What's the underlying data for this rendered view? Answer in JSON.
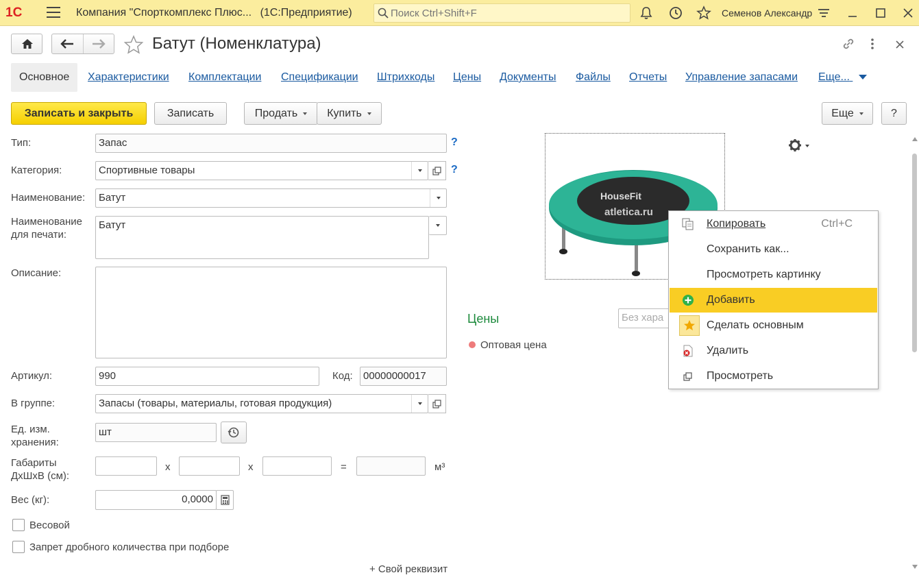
{
  "titlebar": {
    "logo": "1С",
    "title": "Компания \"Спорткомплекс Плюс\" (1С:Предприятие)",
    "title_short": "Компания \"Спорткомплекс Плюс...",
    "app_suffix": "(1С:Предприятие)",
    "search_placeholder": "Поиск Ctrl+Shift+F",
    "user": "Семенов Александр"
  },
  "form": {
    "title": "Батут (Номенклатура)"
  },
  "tabs": [
    {
      "label": "Основное",
      "active": true
    },
    {
      "label": "Характеристики"
    },
    {
      "label": "Комплектации"
    },
    {
      "label": "Спецификации"
    },
    {
      "label": "Штрихкоды"
    },
    {
      "label": "Цены"
    },
    {
      "label": "Документы"
    },
    {
      "label": "Файлы"
    },
    {
      "label": "Отчеты"
    },
    {
      "label": "Управление запасами"
    },
    {
      "label": "Еще..."
    }
  ],
  "toolbar": {
    "save_close": "Записать и закрыть",
    "save": "Записать",
    "sell": "Продать",
    "buy": "Купить",
    "more": "Еще",
    "help": "?"
  },
  "fields": {
    "type_label": "Тип:",
    "type_value": "Запас",
    "category_label": "Категория:",
    "category_value": "Спортивные товары",
    "name_label": "Наименование:",
    "name_value": "Батут",
    "print_name_label_1": "Наименование",
    "print_name_label_2": "для печати:",
    "print_name_value": "Батут",
    "description_label": "Описание:",
    "description_value": "",
    "article_label": "Артикул:",
    "article_value": "990",
    "code_label": "Код:",
    "code_value": "00000000017",
    "group_label": "В группе:",
    "group_value": "Запасы (товары, материалы, готовая продукция)",
    "unit_label_1": "Ед. изм.",
    "unit_label_2": "хранения:",
    "unit_value": "шт",
    "dims_label_1": "Габариты",
    "dims_label_2": "ДхШхВ (см):",
    "dims_x": "x",
    "dims_eq": "=",
    "dims_unit": "м³",
    "weight_label": "Вес (кг):",
    "weight_value": "0,0000",
    "weighted_label": "Весовой",
    "fraction_label": "Запрет дробного количества при подборе",
    "custom_attr": "+ Свой реквизит",
    "help_q": "?"
  },
  "image": {
    "brand_1": "HouseFit",
    "brand_2": "atletica.ru"
  },
  "prices": {
    "title": "Цены",
    "filter_placeholder": "Без хара",
    "item": "Оптовая цена"
  },
  "context_menu": {
    "copy": "Копировать",
    "copy_shortcut": "Ctrl+C",
    "save_as": "Сохранить как...",
    "view_picture": "Просмотреть картинку",
    "add": "Добавить",
    "make_main": "Сделать основным",
    "delete": "Удалить",
    "view": "Просмотреть"
  },
  "colors": {
    "titlebar_bg": "#fbed9e",
    "primary_btn": "#f5cf00",
    "link": "#1a5aa0",
    "prices_title": "#1c8a3c",
    "highlight": "#f9cd24"
  }
}
